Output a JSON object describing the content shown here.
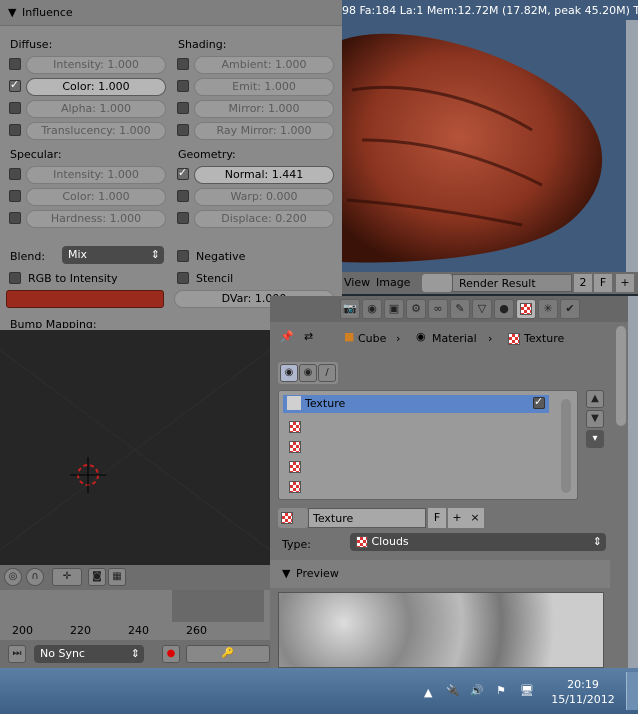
{
  "stats_text": "98 Fa:184 La:1 Mem:12.72M (17.82M, peak 45.20M) Tim",
  "influence": {
    "title": "Influence",
    "diffuse_label": "Diffuse:",
    "shading_label": "Shading:",
    "specular_label": "Specular:",
    "geometry_label": "Geometry:",
    "diffuse": {
      "intensity": "Intensity: 1.000",
      "color": "Color: 1.000",
      "alpha": "Alpha: 1.000",
      "translucency": "Translucency: 1.000"
    },
    "shading": {
      "ambient": "Ambient: 1.000",
      "emit": "Emit: 1.000",
      "mirror": "Mirror: 1.000",
      "ray_mirror": "Ray Mirror: 1.000"
    },
    "specular": {
      "intensity": "Intensity: 1.000",
      "color": "Color: 1.000",
      "hardness": "Hardness: 1.000"
    },
    "geometry": {
      "normal": "Normal: 1.441",
      "warp": "Warp: 0.000",
      "displace": "Displace: 0.200"
    },
    "blend_label": "Blend:",
    "blend_value": "Mix",
    "negative_label": "Negative",
    "rgb_to_intensity_label": "RGB to Intensity",
    "stencil_label": "Stencil",
    "dvar": "DVar: 1.000",
    "bump_mapping_label": "Bump Mapping:",
    "swatch_color": "#9a2a1c"
  },
  "image_header": {
    "view_menu": "View",
    "image_menu": "Image",
    "render_result": "Render Result",
    "slot_number": "2",
    "f_label": "F"
  },
  "breadcrumb": {
    "cube": "Cube",
    "material": "Material",
    "texture": "Texture"
  },
  "texture_list": {
    "selected": "Texture"
  },
  "texture_datablock": {
    "name": "Texture",
    "f_label": "F"
  },
  "type_label": "Type:",
  "type_value": "Clouds",
  "preview_title": "Preview",
  "timeline": {
    "ticks": [
      "200",
      "220",
      "240",
      "260"
    ],
    "sync": "No Sync"
  },
  "taskbar": {
    "time": "20:19",
    "date": "15/11/2012"
  }
}
